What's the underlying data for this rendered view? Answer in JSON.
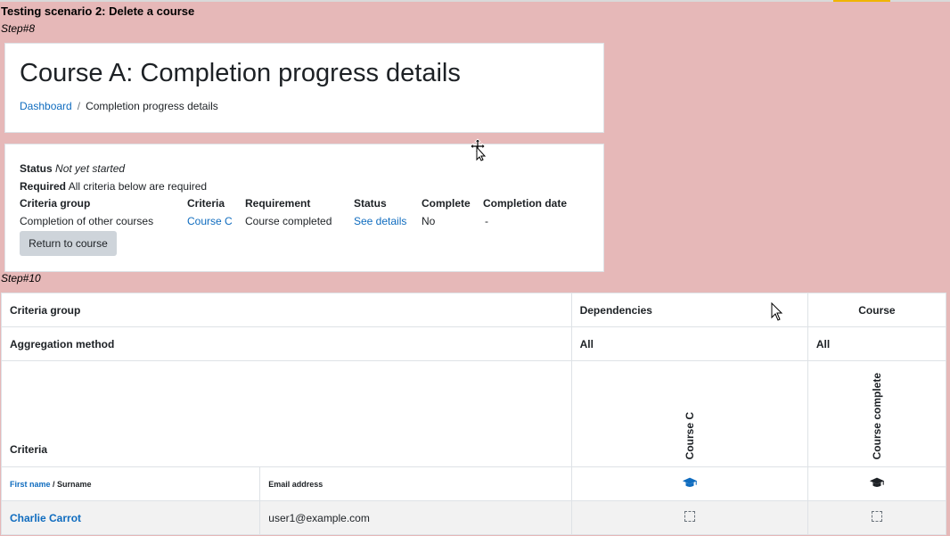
{
  "doc": {
    "title": "Testing scenario 2: Delete a course",
    "step8": "Step#8",
    "step10": "Step#10"
  },
  "header": {
    "title": "Course A: Completion progress details",
    "breadcrumb": {
      "home": "Dashboard",
      "separator": "/",
      "current": "Completion progress details"
    }
  },
  "details": {
    "status_label": "Status",
    "status_value": "Not yet started",
    "required_label": "Required",
    "required_value": "All criteria below are required",
    "columns": [
      "Criteria group",
      "Criteria",
      "Requirement",
      "Status",
      "Complete",
      "Completion date"
    ],
    "row": {
      "group": "Completion of other courses",
      "criteria": "Course C",
      "requirement": "Course completed",
      "status": "See details",
      "complete": "No",
      "date": "-"
    },
    "return_button": "Return to course"
  },
  "report": {
    "criteria_group_label": "Criteria group",
    "dependencies_label": "Dependencies",
    "course_label": "Course",
    "aggregation_label": "Aggregation method",
    "agg_dependencies": "All",
    "agg_course": "All",
    "criteria_label": "Criteria",
    "criteria_course_c": "Course C",
    "criteria_course_complete": "Course complete",
    "firstname_label": "First name",
    "name_sep": " / ",
    "surname_label": "Surname",
    "email_label": "Email address",
    "rows": [
      {
        "name": "Charlie Carrot",
        "email": "user1@example.com"
      }
    ]
  },
  "colors": {
    "page_bg": "#e6b8b8",
    "link": "#0f6cbf",
    "button_bg": "#ced4da"
  },
  "icons": [
    "move-cursor-icon",
    "pointer-cursor-icon",
    "graduation-cap-icon",
    "checkbox-icon"
  ]
}
